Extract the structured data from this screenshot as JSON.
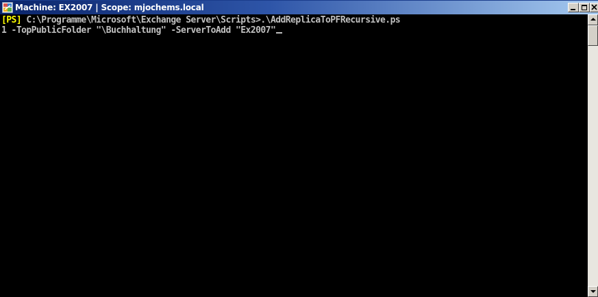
{
  "window": {
    "title": "Machine: EX2007 | Scope: mjochems.local",
    "icon": "exchange-management-shell-icon",
    "buttons": {
      "minimize": "minimize-icon",
      "maximize": "maximize-icon",
      "close": "close-icon"
    }
  },
  "console": {
    "prompt_tag": "[PS]",
    "line1_text": " C:\\Programme\\Microsoft\\Exchange Server\\Scripts>.\\AddReplicaToPFRecursive.ps",
    "line2_text": "1 -TopPublicFolder \"\\Buchhaltung\" -ServerToAdd \"Ex2007\"",
    "colors": {
      "background": "#000000",
      "text": "#c0c0c0",
      "prompt_tag": "#ffff00"
    }
  },
  "scrollbar": {
    "up": "scroll-up-arrow-icon",
    "down": "scroll-down-arrow-icon"
  }
}
